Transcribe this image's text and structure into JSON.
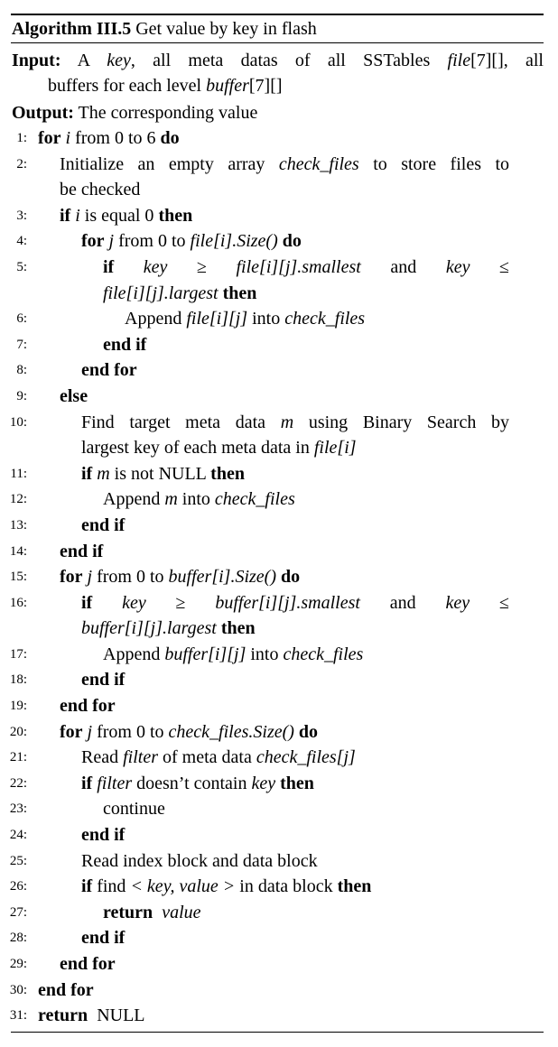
{
  "header": {
    "label": "Algorithm III.5",
    "text": "Get value by key in flash"
  },
  "keywords": {
    "input": "Input:",
    "output": "Output:",
    "for": "for",
    "do": "do",
    "if": "if",
    "then": "then",
    "else": "else",
    "end_if": "end if",
    "end_for": "end for",
    "return": "return"
  },
  "input": {
    "t1": " A ",
    "key": "key",
    "t2": ", all meta datas of all SSTables ",
    "file": "file",
    "sub1": "[7][]",
    "t3": ", all",
    "t4": "buffers for each level ",
    "buffer": "buffer",
    "sub2": "[7][]"
  },
  "output": {
    "text": " The corresponding value"
  },
  "lines": {
    "l1": {
      "a": "from 0 to 6",
      "v": "i"
    },
    "l2": {
      "a": "Initialize an empty array",
      "v": "check_files",
      "b": "to store files to",
      "c": "be checked"
    },
    "l3": {
      "v": "i",
      "a": "is equal 0"
    },
    "l4": {
      "v": "j",
      "a": "from 0 to",
      "expr": "file[i].Size()"
    },
    "l5": {
      "key": "key",
      "ge": "≥",
      "expr1": "file[i][j].smallest",
      "and": "and",
      "key2": "key",
      "le": "≤",
      "expr2": "file[i][j].largest"
    },
    "l6": {
      "a": "Append",
      "expr": "file[i][j]",
      "b": "into",
      "v": "check_files"
    },
    "l10": {
      "a": "Find target meta data",
      "v": "m",
      "b": "using Binary Search by",
      "c": "largest key of each meta data in",
      "expr": "file[i]"
    },
    "l11": {
      "v": "m",
      "a": "is not NULL"
    },
    "l12": {
      "a": "Append",
      "v": "m",
      "b": "into",
      "v2": "check_files"
    },
    "l15": {
      "v": "j",
      "a": "from 0 to",
      "expr": "buffer[i].Size()"
    },
    "l16": {
      "key": "key",
      "ge": "≥",
      "expr1": "buffer[i][j].smallest",
      "and": "and",
      "key2": "key",
      "le": "≤",
      "expr2": "buffer[i][j].largest"
    },
    "l17": {
      "a": "Append",
      "expr": "buffer[i][j]",
      "b": "into",
      "v": "check_files"
    },
    "l20": {
      "v": "j",
      "a": "from 0 to",
      "expr": "check_files.Size()"
    },
    "l21": {
      "a": "Read",
      "v": "filter",
      "b": "of meta data",
      "expr": "check_files[j]"
    },
    "l22": {
      "v": "filter",
      "a": "doesn’t contain",
      "v2": "key"
    },
    "l23": {
      "a": "continue"
    },
    "l25": {
      "a": "Read index block and data block"
    },
    "l26": {
      "a": "find",
      "expr": "< key, value >",
      "b": "in data block"
    },
    "l27": {
      "v": "value"
    },
    "l31": {
      "v": "NULL"
    }
  }
}
